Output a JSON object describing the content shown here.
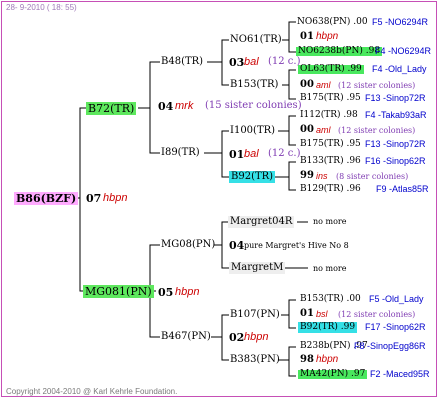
{
  "date": "28- 9-2010 ( 18: 55)",
  "copyright": "Copyright 2004-2010 @ Karl Kehrle Foundation.",
  "colors": {
    "frame": "#c64fb6",
    "pink": "#ffaaff",
    "green": "#5ee85e",
    "cyan": "#35e0e6",
    "name_red": "#cc0000",
    "sister_violet": "#7f3bb2",
    "origin_blue": "#0000cc"
  },
  "gen1": {
    "queen": "B86(BZF)"
  },
  "gen2": [
    {
      "queen": "B72(TR)",
      "num": "07",
      "name": "hbpn"
    },
    {
      "queen": "MG081(PN)",
      "num": "05",
      "name": "hbpn"
    }
  ],
  "gen3": [
    {
      "queen": "B48(TR)",
      "num": "04",
      "name": "mrk",
      "sisters": "(15 sister colonies)"
    },
    {
      "queen": "I89(TR)"
    },
    {
      "queen": "MG08(PN)",
      "num": "04",
      "name": "pure Margret's Hive No 8"
    },
    {
      "queen": "B467(PN)"
    }
  ],
  "gen4": [
    {
      "queen": "NO61(TR)",
      "num": "03",
      "name": "bal",
      "sisters": "(12 c.)"
    },
    {
      "queen": "B153(TR)"
    },
    {
      "queen": "I100(TR)",
      "num": "01",
      "name": "bal",
      "sisters": "(12 c.)"
    },
    {
      "queen": "B92(TR)"
    },
    {
      "queen": "Margret04R",
      "note": "no more"
    },
    {
      "queen": "MargretM",
      "note": "no more"
    },
    {
      "queen": "B107(PN)",
      "num": "02",
      "name": "hbpn"
    },
    {
      "queen": "B383(PN)"
    }
  ],
  "gen5": [
    {
      "line1": "NO638(PN) .00",
      "origin1": "F5 -NO6294R",
      "num": "01",
      "name": "hbpn",
      "line2": "NO6238b(PN) .98",
      "origin2": "F4 -NO6294R"
    },
    {
      "line1": "OL63(TR) .99",
      "origin1": "F4 -Old_Lady",
      "num": "00",
      "name": "aml",
      "sisters": "(12 sister colonies)",
      "line2": "B175(TR) .95",
      "origin2": "F13 -Sinop72R"
    },
    {
      "line1": "I112(TR) .98",
      "origin1": "F4 -Takab93aR",
      "num": "00",
      "name": "aml",
      "sisters": "(12 sister colonies)",
      "line2": "B175(TR) .95",
      "origin2": "F13 -Sinop72R"
    },
    {
      "line1": "B133(TR) .96",
      "origin1": "F16 -Sinop62R",
      "num": "99",
      "name": "ins",
      "sisters": "(8 sister colonies)",
      "line2": "B129(TR) .96",
      "origin2": "F9 -Atlas85R"
    },
    {
      "line1": "B153(TR) .00",
      "origin1": "F5 -Old_Lady",
      "num": "01",
      "name": "bsl",
      "sisters": "(12 sister colonies)",
      "line2": "B92(TR) .99",
      "origin2": "F17 -Sinop62R"
    },
    {
      "line1": "B238b(PN) .97",
      "origin1": "F8 -SinopEgg86R",
      "num": "98",
      "name": "hbpn",
      "line2": "MA42(PN) .97",
      "origin2": "F2 -Maced95R"
    }
  ]
}
